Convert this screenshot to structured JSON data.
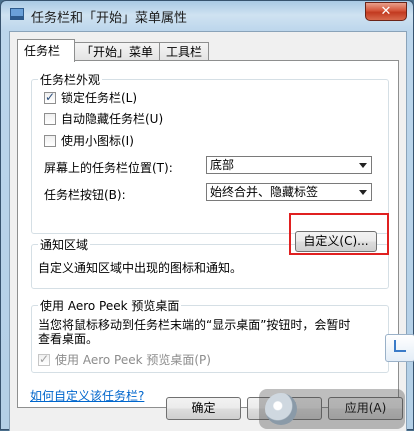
{
  "window": {
    "title": "任务栏和「开始」菜单属性",
    "close_label": "✕"
  },
  "tabs": [
    {
      "label": "任务栏",
      "active": true
    },
    {
      "label": "「开始」菜单",
      "active": false
    },
    {
      "label": "工具栏",
      "active": false
    }
  ],
  "appearance": {
    "group_title": "任务栏外观",
    "lock_taskbar": {
      "label": "锁定任务栏(L)",
      "checked": true
    },
    "autohide": {
      "label": "自动隐藏任务栏(U)",
      "checked": false
    },
    "small_icons": {
      "label": "使用小图标(I)",
      "checked": false
    },
    "location_label": "屏幕上的任务栏位置(T):",
    "location_value": "底部",
    "buttons_label": "任务栏按钮(B):",
    "buttons_value": "始终合并、隐藏标签"
  },
  "notification": {
    "group_title": "通知区域",
    "description": "自定义通知区域中出现的图标和通知。",
    "customize_button": "自定义(C)..."
  },
  "aero": {
    "group_title": "使用 Aero Peek 预览桌面",
    "description_line1": "当您将鼠标移动到任务栏末端的“显示桌面”按钮时，会暂时",
    "description_line2": "查看桌面。",
    "checkbox": {
      "label": "使用 Aero Peek 预览桌面(P)",
      "checked": true,
      "disabled": true
    }
  },
  "help_link": "如何自定义该任务栏?",
  "footer": {
    "ok": "确定",
    "cancel": "取消",
    "apply": "应用(A)"
  },
  "colors": {
    "highlight": "#e02020",
    "link": "#0066cc"
  }
}
